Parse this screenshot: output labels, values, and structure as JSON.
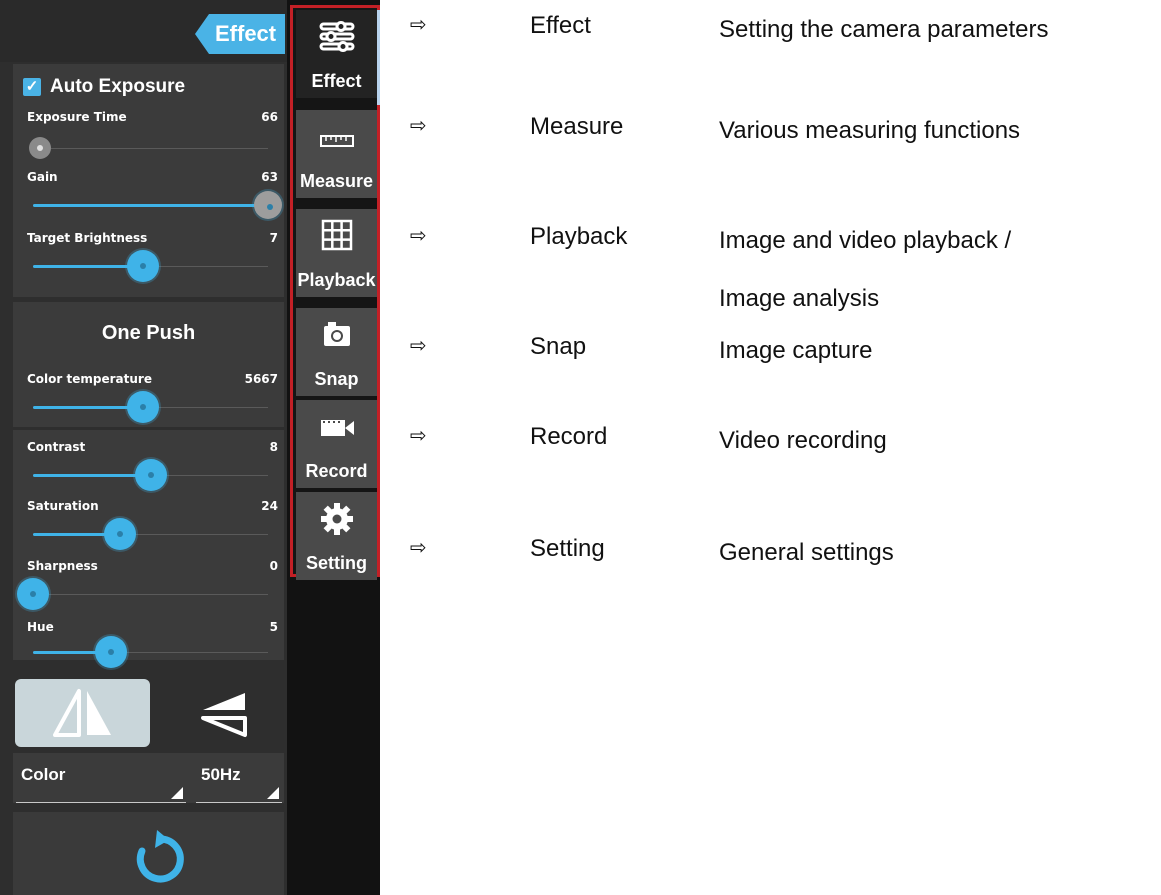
{
  "panel": {
    "tab_title": "Effect",
    "auto_exposure": {
      "checkbox_mark": "✓",
      "title": "Auto Exposure",
      "sliders": [
        {
          "label": "Exposure Time",
          "value": "66",
          "level": 0.03
        },
        {
          "label": "Gain",
          "value": "63",
          "level": 1.0
        },
        {
          "label": "Target Brightness",
          "value": "7",
          "level": 0.47
        }
      ]
    },
    "white_balance": {
      "button": "One Push",
      "sliders": [
        {
          "label": "Color temperature",
          "value": "5667",
          "level": 0.47
        }
      ]
    },
    "adjustments": {
      "sliders": [
        {
          "label": "Contrast",
          "value": "8",
          "level": 0.5
        },
        {
          "label": "Saturation",
          "value": "24",
          "level": 0.37
        },
        {
          "label": "Sharpness",
          "value": "0",
          "level": 0.0
        },
        {
          "label": "Hue",
          "value": "5",
          "level": 0.33
        }
      ]
    },
    "flip_buttons": [
      "flip-horizontal-icon",
      "flip-vertical-icon"
    ],
    "selects": [
      {
        "value": "Color"
      },
      {
        "value": "50Hz"
      }
    ],
    "reset_icon": "reset-icon"
  },
  "toolbar": {
    "accent": "#c32026",
    "items": [
      {
        "label": "Effect",
        "icon": "sliders-icon",
        "active": true
      },
      {
        "label": "Measure",
        "icon": "ruler-icon",
        "active": false
      },
      {
        "label": "Playback",
        "icon": "grid-icon",
        "active": false
      },
      {
        "label": "Snap",
        "icon": "camera-icon",
        "active": false
      },
      {
        "label": "Record",
        "icon": "video-icon",
        "active": false
      },
      {
        "label": "Setting",
        "icon": "gear-icon",
        "active": false
      }
    ]
  },
  "descriptions": [
    {
      "arrow": "⇨",
      "name": "Effect",
      "desc": [
        "Setting the camera parameters"
      ]
    },
    {
      "arrow": "⇨",
      "name": "Measure",
      "desc": [
        "Various measuring functions"
      ]
    },
    {
      "arrow": "⇨",
      "name": "Playback",
      "desc": [
        "Image and video playback /",
        "Image analysis"
      ]
    },
    {
      "arrow": "⇨",
      "name": "Snap",
      "desc": [
        "Image capture"
      ]
    },
    {
      "arrow": "⇨",
      "name": "Record",
      "desc": [
        "Video recording"
      ]
    },
    {
      "arrow": "⇨",
      "name": "Setting",
      "desc": [
        "General settings"
      ]
    }
  ],
  "colors": {
    "accent_blue": "#3fb3e8",
    "panel_bg": "#2e2e2e",
    "frame_red": "#c32026"
  }
}
